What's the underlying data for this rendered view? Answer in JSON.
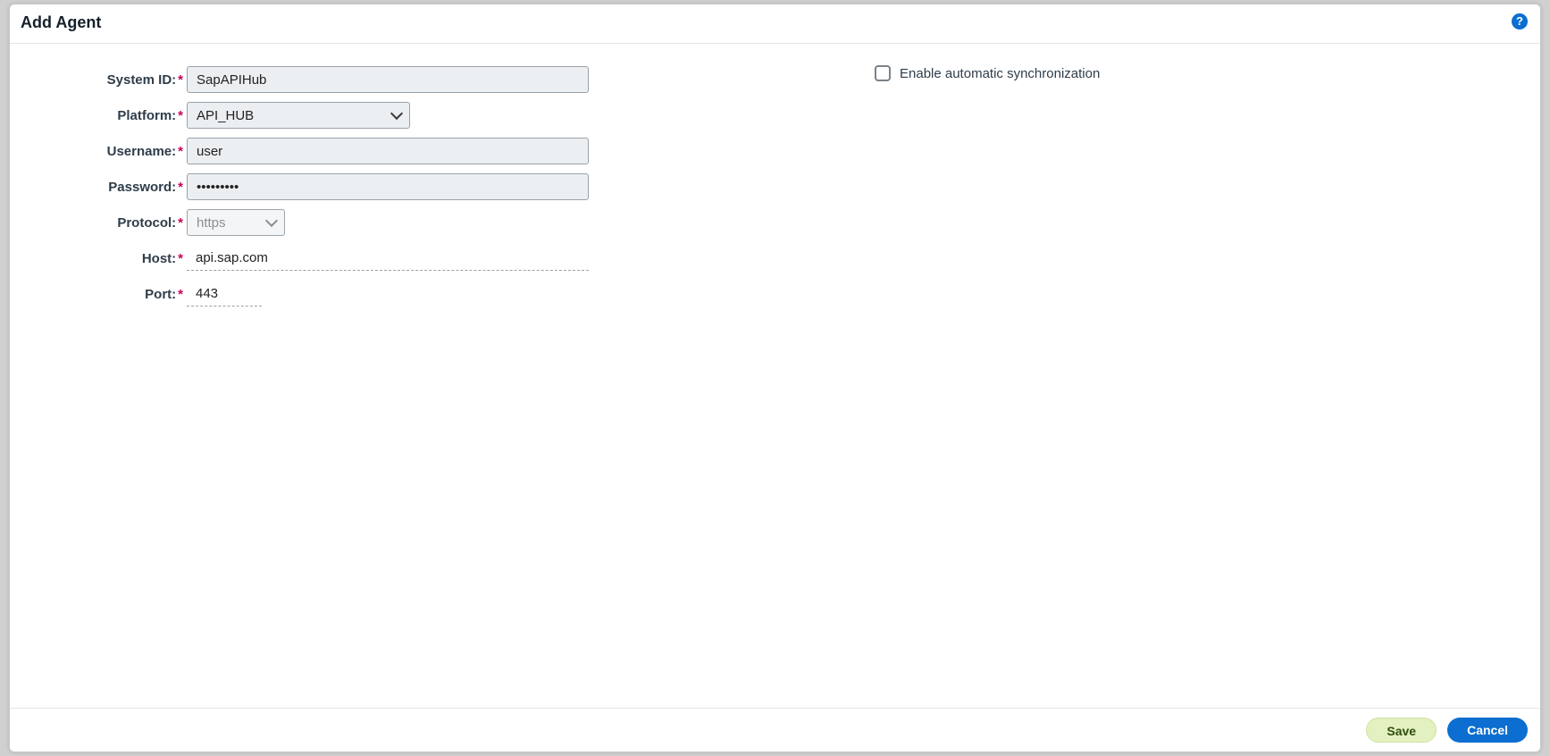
{
  "header": {
    "title": "Add Agent"
  },
  "form": {
    "system_id": {
      "label": "System ID:",
      "value": "SapAPIHub"
    },
    "platform": {
      "label": "Platform:",
      "value": "API_HUB"
    },
    "username": {
      "label": "Username:",
      "value": "user"
    },
    "password": {
      "label": "Password:",
      "value": "•••••••••"
    },
    "protocol": {
      "label": "Protocol:",
      "value": "https"
    },
    "host": {
      "label": "Host:",
      "value": "api.sap.com"
    },
    "port": {
      "label": "Port:",
      "value": "443"
    }
  },
  "options": {
    "auto_sync_label": "Enable automatic synchronization"
  },
  "footer": {
    "save_label": "Save",
    "cancel_label": "Cancel"
  }
}
